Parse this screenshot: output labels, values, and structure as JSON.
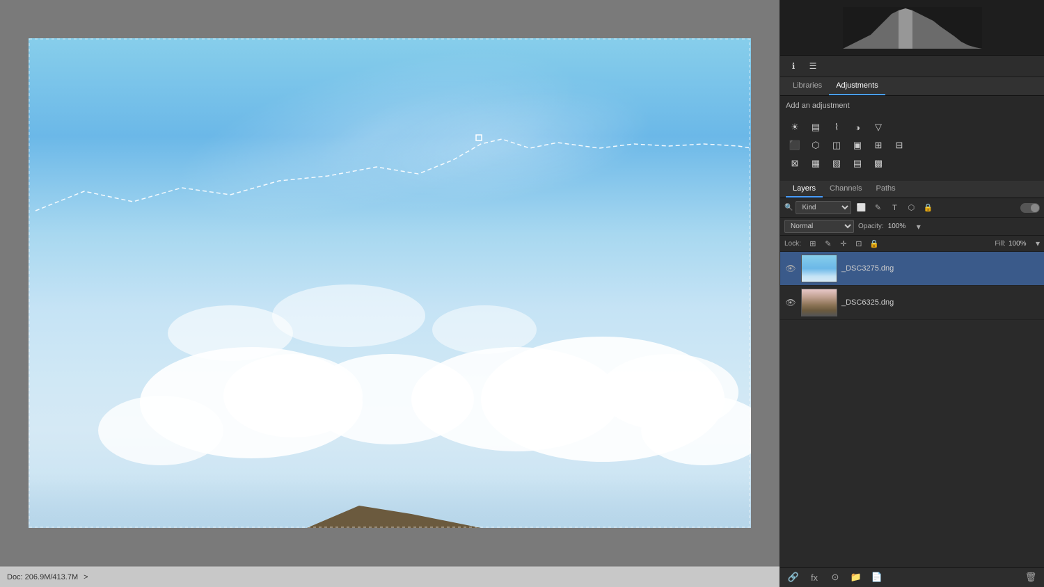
{
  "panel": {
    "histogram_tab": "Histogram",
    "libraries_tab": "Libraries",
    "adjustments_tab": "Adjustments",
    "add_adjustment_label": "Add an adjustment",
    "layers_tab": "Layers",
    "channels_tab": "Channels",
    "paths_tab": "Paths",
    "filter_kind": "Kind",
    "blend_mode": "Normal",
    "opacity_label": "Opacity:",
    "opacity_value": "100%",
    "lock_label": "Lock:",
    "fill_label": "Fill:",
    "fill_value": "100%",
    "layers": [
      {
        "name": "_DSC3275.dng",
        "visible": true,
        "selected": true,
        "type": "sky"
      },
      {
        "name": "_DSC6325.dng",
        "visible": true,
        "selected": false,
        "type": "mountain"
      }
    ]
  },
  "canvas": {
    "doc_info": "Doc: 206.9M/413.7M"
  },
  "bottom_bar": {
    "doc_info": "Doc: 206.9M/413.7M",
    "arrow": ">"
  }
}
